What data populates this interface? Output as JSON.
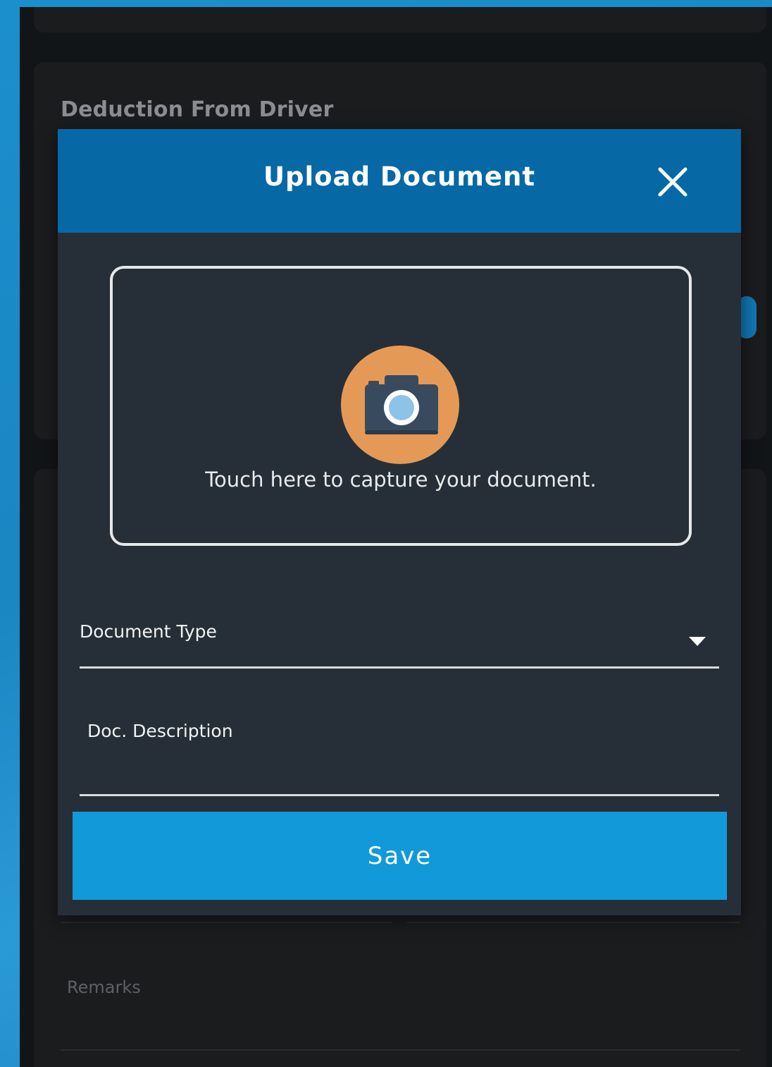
{
  "background": {
    "section_title": "Deduction From Driver",
    "remarks_label": "Remarks"
  },
  "modal": {
    "title": "Upload Document",
    "close_icon": "close-icon",
    "capture": {
      "icon": "camera-icon",
      "text": "Touch here to capture your document."
    },
    "document_type": {
      "label": "Document Type",
      "icon": "dropdown-caret-icon"
    },
    "doc_description": {
      "label": "Doc. Description",
      "value": ""
    },
    "save_label": "Save"
  },
  "colors": {
    "header": "#0669a6",
    "modal_body": "#262f37",
    "save_button": "#1199d9",
    "camera_circle": "#e49a56"
  }
}
